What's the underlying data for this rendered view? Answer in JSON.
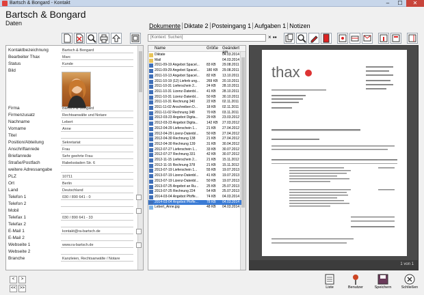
{
  "window": {
    "title": "Bartsch & Bongard - Kontakt",
    "min": "–",
    "max": "☐",
    "close": "✕"
  },
  "header": {
    "title": "Bartsch & Bongard",
    "subtitle": "Daten"
  },
  "tabs": [
    {
      "label": "Dokumente",
      "active": true
    },
    {
      "label": "Diktate 2",
      "active": false
    },
    {
      "label": "Posteingang 1",
      "active": false
    },
    {
      "label": "Aufgaben 1",
      "active": false
    },
    {
      "label": "Notizen",
      "active": false
    }
  ],
  "search": {
    "placeholder": "[Kontext: Suchen]",
    "clear": "× ▪▪"
  },
  "form": {
    "fields": [
      {
        "label": "Kontaktbezeichnung",
        "value": "Bartsch & Bongard"
      },
      {
        "label": "Bearbeiter Thax",
        "value": "Marc"
      },
      {
        "label": "Status",
        "value": "Kunde"
      },
      {
        "label": "Bild",
        "value": ""
      },
      {
        "label": "Firma",
        "value": "Bartsch & Bongard"
      },
      {
        "label": "Firmenzusatz",
        "value": "Rechtsanwälte und Notare"
      },
      {
        "label": "Nachname",
        "value": "Lebert"
      },
      {
        "label": "Vorname",
        "value": "Anne"
      },
      {
        "label": "Titel",
        "value": ""
      },
      {
        "label": "Position/Abteilung",
        "value": "Sekretariat"
      },
      {
        "label": "Anschriftanrede",
        "value": "Frau"
      },
      {
        "label": "Briefanrede",
        "value": "Sehr geehrte Frau"
      },
      {
        "label": "Straße/Postfach",
        "value": "Rabelsstaden Str. 6"
      },
      {
        "label": "weitere Adressangabe",
        "value": ""
      },
      {
        "label": "PLZ",
        "value": "10711"
      },
      {
        "label": "Ort",
        "value": "Berlin"
      },
      {
        "label": "Land",
        "value": "Deutschland"
      },
      {
        "label": "Telefon 1",
        "value": "030 / 890 641 - 0"
      },
      {
        "label": "Telefon 2",
        "value": ""
      },
      {
        "label": "Mobil",
        "value": ""
      },
      {
        "label": "Telefax 1",
        "value": "030 / 890 641 - 33"
      },
      {
        "label": "Telefax 2",
        "value": ""
      },
      {
        "label": "E-Mail 1",
        "value": "kontakt@ra-bartsch.de"
      },
      {
        "label": "E-Mail 2",
        "value": ""
      },
      {
        "label": "Webseite 1",
        "value": "www.ra-bartsch.de"
      },
      {
        "label": "Webseite 2",
        "value": ""
      },
      {
        "label": "Branche",
        "value": "Kanzleien, Rechtsanwälte / Notare"
      }
    ]
  },
  "filelist": {
    "headers": {
      "name": "Name",
      "size": "Größe",
      "date": "Geändert am"
    },
    "rows": [
      {
        "name": "Diktate",
        "size": "",
        "date": "04.03.2014",
        "type": "folder"
      },
      {
        "name": "Mail",
        "size": "",
        "date": "04.03.2014",
        "type": "folder"
      },
      {
        "name": "2011-09-19 Angebot Spacel...",
        "size": "83 KB",
        "date": "29.08.2011",
        "type": "doc"
      },
      {
        "name": "2011-09-29 Angebot Spacel...",
        "size": "180 KB",
        "date": "29.08.2011",
        "type": "doc"
      },
      {
        "name": "2011-10-13 Angebot Spacel...",
        "size": "82 KB",
        "date": "13.10.2011",
        "type": "doc"
      },
      {
        "name": "2011-10-19 (12) Lieferb ung...",
        "size": "269 KB",
        "date": "20.10.2011",
        "type": "doc"
      },
      {
        "name": "2011-10-31 Lieferschein 2...",
        "size": "24 KB",
        "date": "28.10.2011",
        "type": "doc"
      },
      {
        "name": "2011-10-31 Lizenz-Datenbl...",
        "size": "41 KB",
        "date": "28.10.2011",
        "type": "doc"
      },
      {
        "name": "2011-10-31 Lizenz-Datenbl...",
        "size": "50 KB",
        "date": "30.10.2011",
        "type": "doc"
      },
      {
        "name": "2011-10-31 Rechnung 340",
        "size": "22 KB",
        "date": "02.11.2011",
        "type": "doc"
      },
      {
        "name": "2011-11-02 Anschreiben D...",
        "size": "18 KB",
        "date": "02.11.2011",
        "type": "doc"
      },
      {
        "name": "2011-11-02 Rechnung 348",
        "size": "70 KB",
        "date": "03.11.2011",
        "type": "doc"
      },
      {
        "name": "2012-03-23 Angebot Digita...",
        "size": "29 KB",
        "date": "23.03.2012",
        "type": "doc"
      },
      {
        "name": "2012-03-23 Angebot Digita...",
        "size": "142 KB",
        "date": "27.03.2012",
        "type": "doc"
      },
      {
        "name": "2012-04-29 Lieferschein 1...",
        "size": "21 KB",
        "date": "27.04.2012",
        "type": "doc"
      },
      {
        "name": "2012-04-29 Lizenz-Datenbl...",
        "size": "50 KB",
        "date": "27.04.2012",
        "type": "doc"
      },
      {
        "name": "2012-04-30 Rechnung 138",
        "size": "21 KB",
        "date": "27.04.2012",
        "type": "doc"
      },
      {
        "name": "2012-04-30 Rechnung 139",
        "size": "31 KB",
        "date": "30.04.2012",
        "type": "doc"
      },
      {
        "name": "2012-07-27 Lieferschein 1...",
        "size": "33 KB",
        "date": "30.07.2012",
        "type": "doc"
      },
      {
        "name": "2012-07-27 Rechnung 331",
        "size": "42 KB",
        "date": "30.07.2012",
        "type": "doc"
      },
      {
        "name": "2012-11-15 Lieferschein 2...",
        "size": "21 KB",
        "date": "15.11.2012",
        "type": "doc"
      },
      {
        "name": "2012-11-15 Rechnung 378",
        "size": "21 KB",
        "date": "15.11.2012",
        "type": "doc"
      },
      {
        "name": "2013-07-19 Lieferschein 1...",
        "size": "55 KB",
        "date": "19.07.2013",
        "type": "doc"
      },
      {
        "name": "2013-07-19 Lizenz-Datenbl...",
        "size": "41 KB",
        "date": "19.07.2013",
        "type": "doc"
      },
      {
        "name": "2013-07-19 Lizenz-Datenbl...",
        "size": "50 KB",
        "date": "19.07.2013",
        "type": "doc"
      },
      {
        "name": "2013-07-25 Angebot an Ru...",
        "size": "25 KB",
        "date": "25.07.2013",
        "type": "doc"
      },
      {
        "name": "2013-07-25 Rechnung 224",
        "size": "54 KB",
        "date": "25.07.2013",
        "type": "doc"
      },
      {
        "name": "2014-03-04 Angebot Pfoffe...",
        "size": "74 KB",
        "date": "04.03.2014",
        "type": "doc"
      },
      {
        "name": "2014-03-04 Angebot Pfoffe...",
        "size": "78 KB",
        "date": "04.03.2014",
        "type": "doc",
        "selected": true
      },
      {
        "name": "Lebert_Anne.jpg",
        "size": "48 KB",
        "date": "04.03.2014",
        "type": "img"
      }
    ]
  },
  "preview": {
    "page_indicator": "1 von 1",
    "logo": "thax"
  },
  "nav": {
    "prev": "<",
    "next": ">",
    "first": "<<",
    "last": ">>"
  },
  "bottom_buttons": [
    {
      "label": "Liste",
      "icon": "list-icon"
    },
    {
      "label": "Benutzer",
      "icon": "pin-icon"
    },
    {
      "label": "Speichern",
      "icon": "save-icon"
    },
    {
      "label": "Schließen",
      "icon": "close-circle-icon"
    }
  ],
  "colors": {
    "accent": "#3a7bd5",
    "danger": "#c8453b",
    "titlebar": "#c7d6ea"
  }
}
